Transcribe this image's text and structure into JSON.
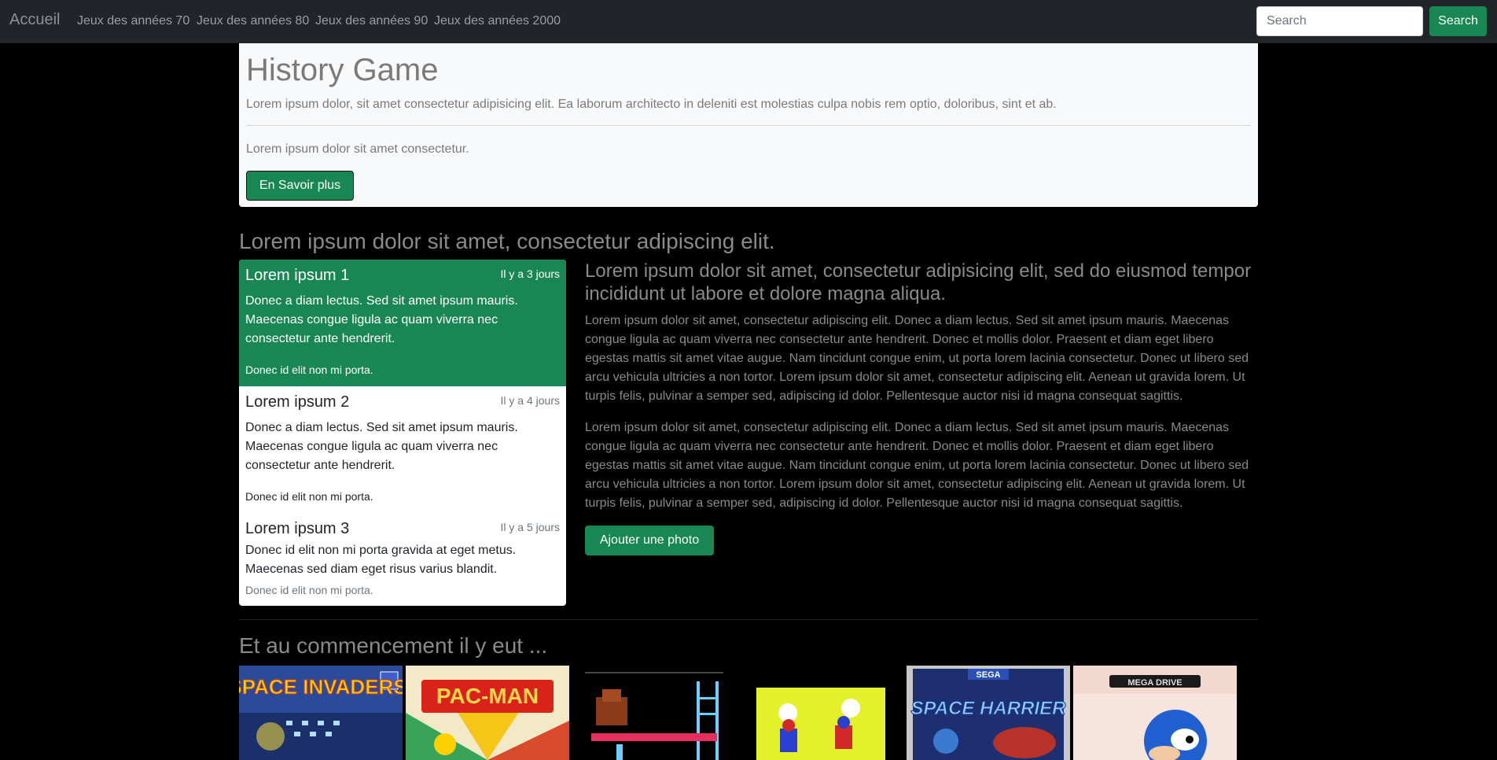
{
  "navbar": {
    "brand": "Accueil",
    "links": [
      "Jeux des années 70",
      "Jeux des années 80",
      "Jeux des années 90",
      "Jeux des années 2000"
    ],
    "search_placeholder": "Search",
    "search_button": "Search"
  },
  "jumbotron": {
    "title": "History Game",
    "lead": "Lorem ipsum dolor, sit amet consectetur adipisicing elit. Ea laborum architecto in deleniti est molestias culpa nobis rem optio, doloribus, sint et ab.",
    "text": "Lorem ipsum dolor sit amet consectetur.",
    "button": "En Savoir plus"
  },
  "section_heading": "Lorem ipsum dolor sit amet, consectetur adipiscing elit.",
  "list_items": [
    {
      "title": "Lorem ipsum 1",
      "time": "Il y a 3 jours",
      "text": "Donec a diam lectus. Sed sit amet ipsum mauris. Maecenas congue ligula ac quam viverra nec consectetur ante hendrerit.",
      "small": "Donec id elit non mi porta.",
      "active": true
    },
    {
      "title": "Lorem ipsum 2",
      "time": "Il y a 4 jours",
      "text": "Donec a diam lectus. Sed sit amet ipsum mauris. Maecenas congue ligula ac quam viverra nec consectetur ante hendrerit.",
      "small": "Donec id elit non mi porta.",
      "active": false
    },
    {
      "title": "Lorem ipsum 3",
      "time": "Il y a 5 jours",
      "text": "Donec id elit non mi porta gravida at eget metus. Maecenas sed diam eget risus varius blandit.",
      "small": "Donec id elit non mi porta.",
      "active": false
    }
  ],
  "article": {
    "heading": "Lorem ipsum dolor sit amet, consectetur adipisicing elit, sed do eiusmod tempor incididunt ut labore et dolore magna aliqua.",
    "paragraphs": [
      "Lorem ipsum dolor sit amet, consectetur adipiscing elit. Donec a diam lectus. Sed sit amet ipsum mauris. Maecenas congue ligula ac quam viverra nec consectetur ante hendrerit. Donec et mollis dolor. Praesent et diam eget libero egestas mattis sit amet vitae augue. Nam tincidunt congue enim, ut porta lorem lacinia consectetur. Donec ut libero sed arcu vehicula ultricies a non tortor. Lorem ipsum dolor sit amet, consectetur adipiscing elit. Aenean ut gravida lorem. Ut turpis felis, pulvinar a semper sed, adipiscing id dolor. Pellentesque auctor nisi id magna consequat sagittis.",
      "Lorem ipsum dolor sit amet, consectetur adipiscing elit. Donec a diam lectus. Sed sit amet ipsum mauris. Maecenas congue ligula ac quam viverra nec consectetur ante hendrerit. Donec et mollis dolor. Praesent et diam eget libero egestas mattis sit amet vitae augue. Nam tincidunt congue enim, ut porta lorem lacinia consectetur. Donec ut libero sed arcu vehicula ultricies a non tortor. Lorem ipsum dolor sit amet, consectetur adipiscing elit. Aenean ut gravida lorem. Ut turpis felis, pulvinar a semper sed, adipiscing id dolor. Pellentesque auctor nisi id magna consequat sagittis."
    ],
    "button": "Ajouter une photo"
  },
  "gallery": {
    "heading": "Et au commencement il y eut ...",
    "thumbnails": [
      {
        "name": "space-invaders-cover",
        "logo": "SPACE INVADERS"
      },
      {
        "name": "pac-man-cover",
        "logo": "PAC-MAN"
      },
      {
        "name": "donkey-kong-cover",
        "logo": ""
      },
      {
        "name": "mario-bros-cover",
        "logo": ""
      },
      {
        "name": "space-harrier-cover",
        "logo": "SPACE HARRIER"
      },
      {
        "name": "sonic-mega-drive-cover",
        "logo": "MEGA DRIVE"
      }
    ]
  },
  "colors": {
    "navbar_bg": "#212529",
    "accent_green": "#198754",
    "page_bg": "#000000",
    "jumbotron_bg": "#f8f9fa"
  }
}
